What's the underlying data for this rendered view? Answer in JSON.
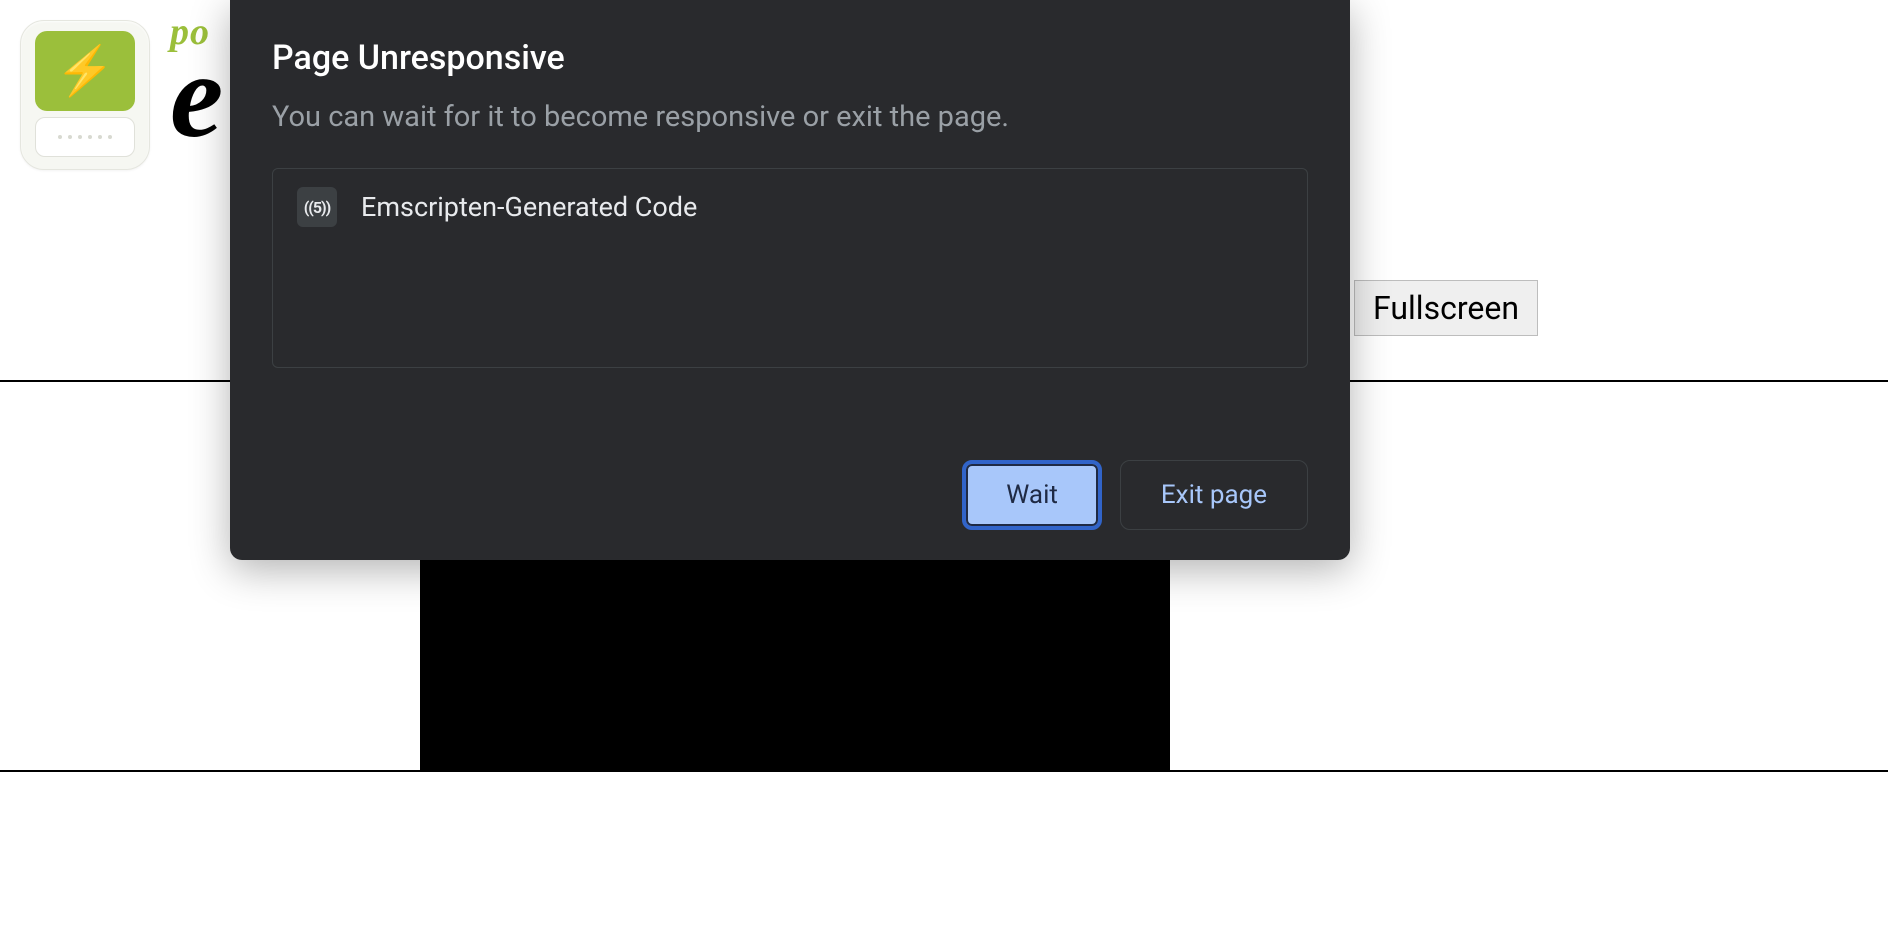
{
  "page": {
    "brand_small": "po",
    "brand_big": "e",
    "fullscreen_label": "Fullscreen"
  },
  "dialog": {
    "title": "Page Unresponsive",
    "subtitle": "You can wait for it to become responsive or exit the page.",
    "items": [
      {
        "favicon_text": "((5))",
        "label": "Emscripten-Generated Code"
      }
    ],
    "wait_label": "Wait",
    "exit_label": "Exit page"
  }
}
